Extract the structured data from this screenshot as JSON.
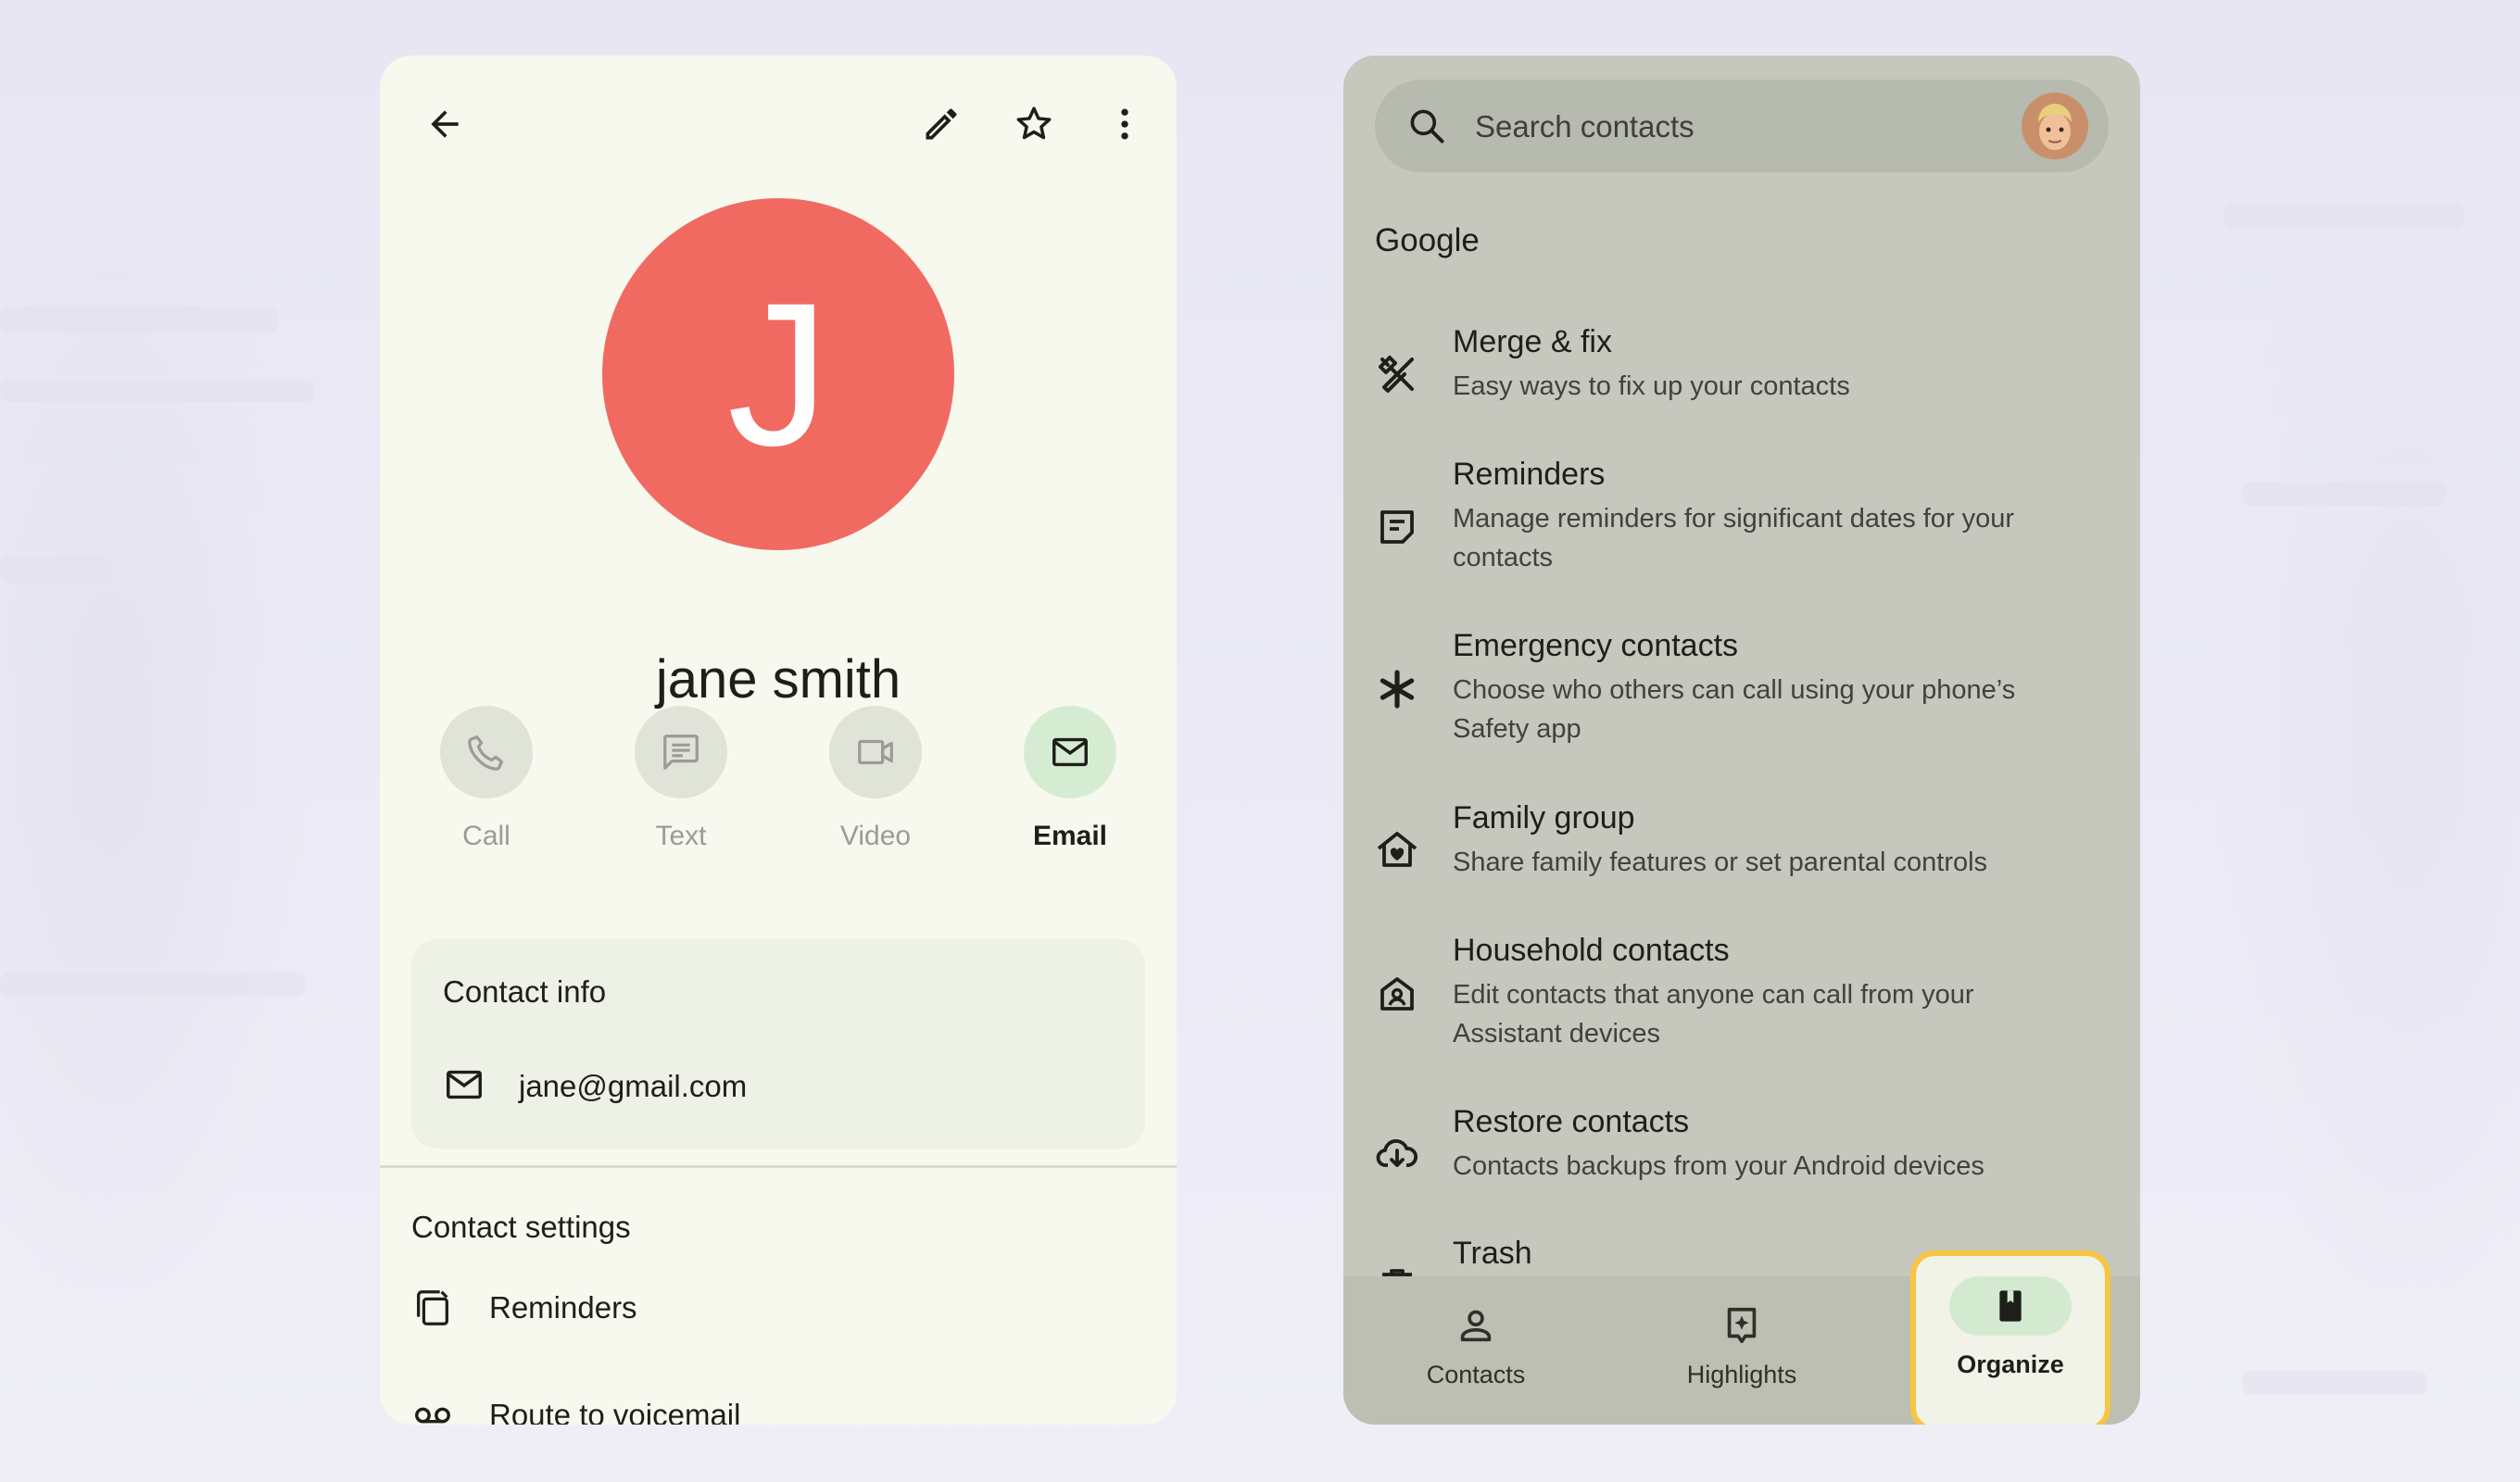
{
  "contact": {
    "initial": "J",
    "name": "jane smith",
    "actions": [
      {
        "label": "Call",
        "icon": "phone-icon",
        "active": false
      },
      {
        "label": "Text",
        "icon": "message-icon",
        "active": false
      },
      {
        "label": "Video",
        "icon": "video-icon",
        "active": false
      },
      {
        "label": "Email",
        "icon": "mail-icon",
        "active": true
      }
    ],
    "info": {
      "title": "Contact info",
      "email": "jane@gmail.com"
    },
    "settings": {
      "title": "Contact settings",
      "items": [
        {
          "label": "Reminders",
          "icon": "reminders-icon"
        },
        {
          "label": "Route to voicemail",
          "icon": "voicemail-icon"
        }
      ]
    }
  },
  "organize": {
    "search_placeholder": "Search contacts",
    "section": "Google",
    "items": [
      {
        "title": "Merge & fix",
        "subtitle": "Easy ways to fix up your contacts",
        "icon": "tools-icon"
      },
      {
        "title": "Reminders",
        "subtitle": "Manage reminders for significant dates for your contacts",
        "icon": "note-icon"
      },
      {
        "title": "Emergency contacts",
        "subtitle": "Choose who others can call using your phone’s Safety app",
        "icon": "asterisk-icon"
      },
      {
        "title": "Family group",
        "subtitle": "Share family features or set parental controls",
        "icon": "family-home-icon"
      },
      {
        "title": "Household contacts",
        "subtitle": "Edit contacts that anyone can call from your Assistant devices",
        "icon": "household-icon"
      },
      {
        "title": "Restore contacts",
        "subtitle": "Contacts backups from your Android devices",
        "icon": "cloud-restore-icon"
      },
      {
        "title": "Trash",
        "subtitle": "",
        "icon": "trash-icon"
      }
    ],
    "nav": [
      {
        "label": "Contacts",
        "icon": "person-icon"
      },
      {
        "label": "Highlights",
        "icon": "highlights-icon"
      },
      {
        "label": "Organize",
        "icon": "bookmark-book-icon",
        "active": true
      }
    ]
  },
  "colors": {
    "avatar": "#f16a62",
    "highlight_border": "#f8c542",
    "active_pill": "#d4ead0"
  }
}
